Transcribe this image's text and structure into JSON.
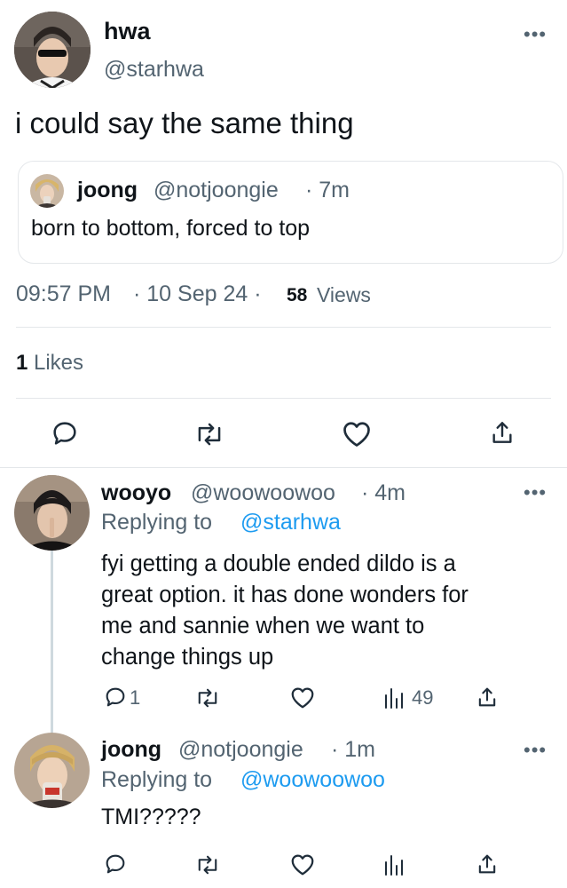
{
  "main_tweet": {
    "display_name": "hwa",
    "handle": "@starhwa",
    "text": "i could say the same thing",
    "quoted": {
      "display_name": "joong",
      "handle": "@notjoongie",
      "time": "· 7m",
      "text": "born to bottom, forced to top"
    },
    "time": "09:57 PM",
    "date": "· 10 Sep 24 ·",
    "views_count": "58",
    "views_label": "Views",
    "likes_count": "1",
    "likes_label": "Likes"
  },
  "replies": [
    {
      "display_name": "wooyo",
      "handle": "@woowoowoo",
      "time": "· 4m",
      "replying_label": "Replying to",
      "replying_to": "@starhwa",
      "text_lines": [
        "fyi getting a double ended dildo is a",
        "great option. it has done wonders for",
        "me and sannie when we want to",
        "change things up"
      ],
      "reply_count": "1",
      "views_count": "49"
    },
    {
      "display_name": "joong",
      "handle": "@notjoongie",
      "time": "· 1m",
      "replying_label": "Replying to",
      "replying_to": "@woowoowoo",
      "text": "TMI?????"
    }
  ],
  "icons": {
    "reply": "reply-icon",
    "retweet": "retweet-icon",
    "like": "heart-icon",
    "share": "share-icon",
    "views": "views-icon",
    "more": "more-icon"
  },
  "colors": {
    "accent": "#1d9bf0",
    "text": "#0f1419",
    "secondary": "#536471"
  }
}
